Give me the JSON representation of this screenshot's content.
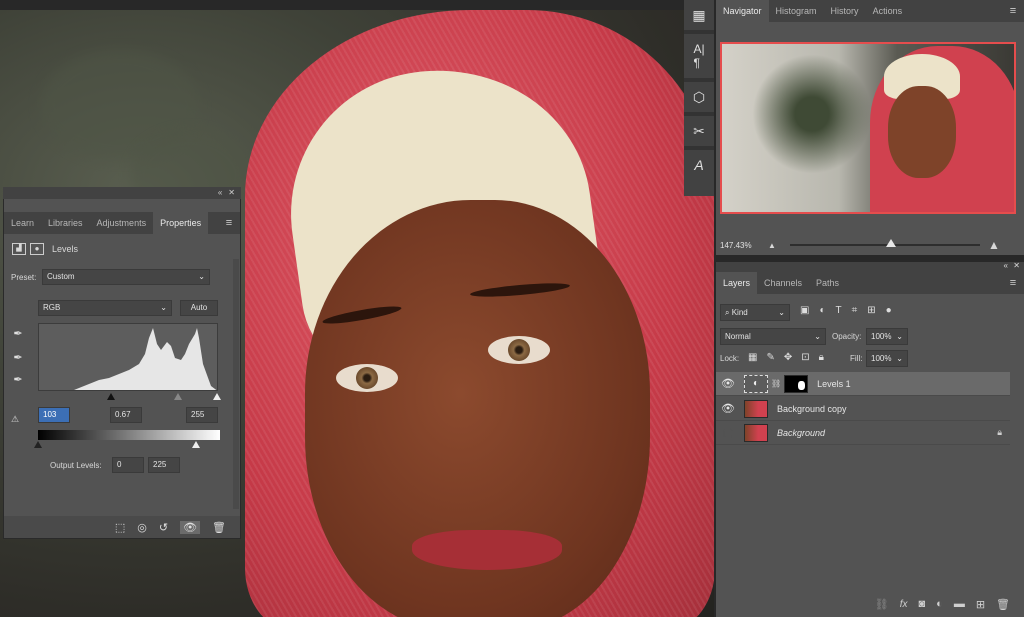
{
  "toolstrip": {
    "icons": [
      "grid-icon",
      "character-icon",
      "3d-cube-icon",
      "tools-icon",
      "glyphs-icon"
    ]
  },
  "navigator": {
    "tabs": [
      {
        "label": "Navigator",
        "active": true
      },
      {
        "label": "Histogram",
        "active": false
      },
      {
        "label": "History",
        "active": false
      },
      {
        "label": "Actions",
        "active": false
      }
    ],
    "zoom": "147.43%"
  },
  "layers": {
    "tabs": [
      {
        "label": "Layers",
        "active": true
      },
      {
        "label": "Channels",
        "active": false
      },
      {
        "label": "Paths",
        "active": false
      }
    ],
    "filter": "Kind",
    "blend_mode": "Normal",
    "opacity_label": "Opacity:",
    "opacity": "100%",
    "lock_label": "Lock:",
    "fill_label": "Fill:",
    "fill": "100%",
    "items": [
      {
        "name": "Levels 1",
        "visible": true,
        "selected": true,
        "type": "adjustment"
      },
      {
        "name": "Background copy",
        "visible": true,
        "selected": false,
        "type": "pixel"
      },
      {
        "name": "Background",
        "visible": false,
        "selected": false,
        "type": "pixel",
        "locked": true
      }
    ]
  },
  "properties": {
    "tabs": [
      {
        "label": "Learn",
        "active": false
      },
      {
        "label": "Libraries",
        "active": false
      },
      {
        "label": "Adjustments",
        "active": false
      },
      {
        "label": "Properties",
        "active": true
      }
    ],
    "adjustment_name": "Levels",
    "preset_label": "Preset:",
    "preset": "Custom",
    "channel": "RGB",
    "auto_label": "Auto",
    "input_black": "103",
    "input_gamma": "0.67",
    "input_white": "255",
    "output_label": "Output Levels:",
    "output_black": "0",
    "output_white": "225"
  },
  "colors": {
    "panel": "#535353",
    "tab_bar": "#424242",
    "selected_layer": "#6a6a6a",
    "navigator_frame": "#e54d4d"
  }
}
